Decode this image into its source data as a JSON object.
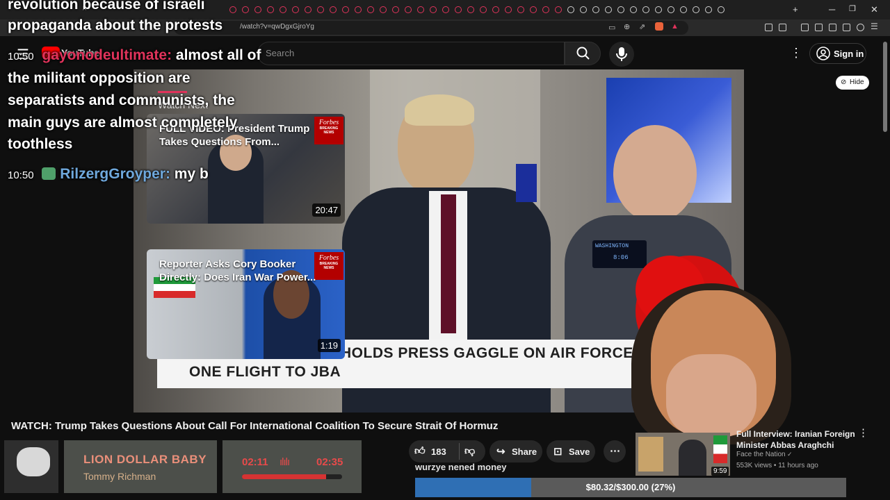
{
  "browser": {
    "url": "/watch?v=qwDgxGjroYg",
    "tab_close": "×",
    "new_tab": "+"
  },
  "header": {
    "search_placeholder": "Search",
    "sign_in": "Sign in",
    "logo": "YouTube"
  },
  "video": {
    "lower_third_line1": "HOLDS PRESS GAGGLE ON AIR FORCE",
    "lower_third_line2": "ONE FLIGHT TO JBA",
    "hide_label": "Hide",
    "watch_next_label": "Watch Next",
    "monitor_label": "WASHINGTON",
    "monitor_time": "8:06"
  },
  "suggestions": [
    {
      "title": "FULL VIDEO: President Trump Takes Questions From...",
      "duration": "20:47",
      "badge": "Forbes",
      "badge_sub": "BREAKING NEWS"
    },
    {
      "title": "Reporter Asks Cory Booker Directly: Does Iran War Power...",
      "duration": "1:19",
      "badge": "Forbes",
      "badge_sub": "BREAKING NEWS"
    }
  ],
  "chat": {
    "line0": "revolution because of israeli",
    "line1": "propaganda about the protests",
    "msg1_time": "10:50",
    "msg1_user": "gayonodeultimate:",
    "msg1_text1": "almost all of",
    "msg1_text2": "the militant opposition are",
    "msg1_text3": "separatists and communists, the",
    "msg1_text4": "main guys are almost completely",
    "msg1_text5": "toothless",
    "msg2_time": "10:50",
    "msg2_user": "RilzergGroyper:",
    "msg2_text": "my b"
  },
  "below": {
    "title": "WATCH: Trump Takes Questions About Call For International Coalition To Secure Strait Of Hormuz",
    "likes": "183",
    "share": "Share",
    "save": "Save"
  },
  "now_playing": {
    "title": "LION DOLLAR BABY",
    "artist": "Tommy Richman",
    "current": "02:11",
    "total": "02:35",
    "progress": 0.84
  },
  "donation": {
    "text": "wurzye nened money",
    "label": "$80.32/$300.00 (27%)",
    "progress": 0.27
  },
  "sidebar_video": {
    "title": "Full Interview: Iranian Foreign Minister Abbas Araghchi",
    "channel": "Face the Nation",
    "meta": "553K views • 11 hours ago",
    "duration": "9:59"
  },
  "colors": {
    "accent_red": "#e0335b",
    "chat_user1": "#e0335b",
    "chat_user2": "#6fa8dc",
    "donate_fill": "#2f6fb4"
  }
}
